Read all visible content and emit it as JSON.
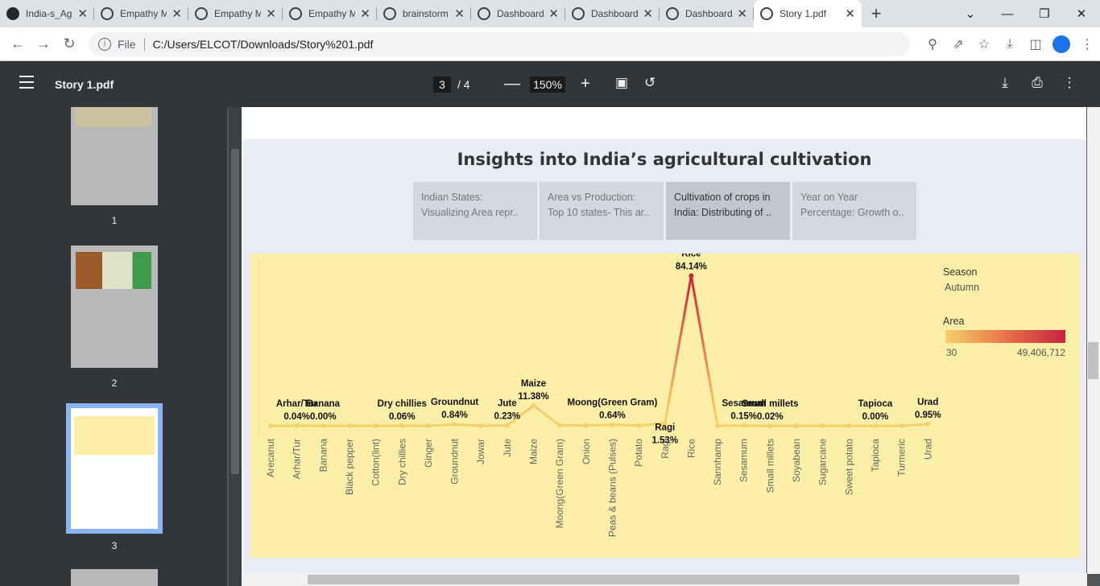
{
  "browser": {
    "tabs": [
      {
        "label": "India-s_Ag",
        "icon": "github-icon"
      },
      {
        "label": "Empathy M",
        "icon": "globe-icon"
      },
      {
        "label": "Empathy M",
        "icon": "globe-icon"
      },
      {
        "label": "Empathy M",
        "icon": "globe-icon"
      },
      {
        "label": "brainstorm",
        "icon": "globe-icon"
      },
      {
        "label": "Dashboard",
        "icon": "globe-icon"
      },
      {
        "label": "Dashboard",
        "icon": "globe-icon"
      },
      {
        "label": "Dashboard",
        "icon": "globe-icon"
      },
      {
        "label": "Story 1.pdf",
        "icon": "globe-icon",
        "active": true
      }
    ],
    "address": {
      "scheme": "File",
      "url": "C:/Users/ELCOT/Downloads/Story%201.pdf"
    }
  },
  "pdf": {
    "title": "Story 1.pdf",
    "current_page": "3",
    "total_pages": "/  4",
    "zoom": "150%",
    "thumbnails": [
      "1",
      "2",
      "3"
    ]
  },
  "dashboard": {
    "title": "Insights into India’s agricultural cultivation",
    "story_points": [
      {
        "line1": "Indian States:",
        "line2": "Visualizing Area repr.."
      },
      {
        "line1": "Area vs Production:",
        "line2": "Top 10 states- This ar.."
      },
      {
        "line1": "Cultivation of crops in",
        "line2": "India: Distributing of ..",
        "active": true
      },
      {
        "line1": "Year on Year",
        "line2": "Percentage: Growth o.."
      }
    ],
    "legend": {
      "season_title": "Season",
      "season_value": "Autumn",
      "area_title": "Area",
      "area_min": "30",
      "area_max": "49,406,712",
      "colors": {
        "low": "#f5d06a",
        "mid": "#e8734a",
        "high": "#c8233f"
      }
    }
  },
  "chart_data": {
    "type": "line",
    "title": "",
    "xlabel": "",
    "ylabel": "",
    "categories": [
      "Arecanut",
      "Arhar/Tur",
      "Banana",
      "Black pepper",
      "Cotton(lint)",
      "Dry chillies",
      "Ginger",
      "Groundnut",
      "Jowar",
      "Jute",
      "Maize",
      "Moong(Green Gram)",
      "Onion",
      "Peas & beans (Pulses)",
      "Potato",
      "Ragi",
      "Rice",
      "Sannhamp",
      "Sesamum",
      "Small millets",
      "Soyabean",
      "Sugarcane",
      "Sweet potato",
      "Tapioca",
      "Turmeric",
      "Urad"
    ],
    "series": [
      {
        "values": [
          0.0,
          0.04,
          0.0,
          0.0,
          0.0,
          0.06,
          0.0,
          0.84,
          0.0,
          0.23,
          11.38,
          0.3,
          0.1,
          0.64,
          0.1,
          1.53,
          84.14,
          0.05,
          0.15,
          0.02,
          0.0,
          0.0,
          0.0,
          0.0,
          0.0,
          0.95
        ]
      }
    ],
    "ylim": [
      0,
      88
    ],
    "point_labels": [
      {
        "index": 1,
        "line1": "Arhar/Tur",
        "line2": "0.04%",
        "pos": "above"
      },
      {
        "index": 2,
        "line1": "Banana",
        "line2": "0.00%",
        "pos": "above"
      },
      {
        "index": 5,
        "line1": "Dry chillies",
        "line2": "0.06%",
        "pos": "above"
      },
      {
        "index": 7,
        "line1": "Groundnut",
        "line2": "0.84%",
        "pos": "above"
      },
      {
        "index": 9,
        "line1": "Jute",
        "line2": "0.23%",
        "pos": "above"
      },
      {
        "index": 10,
        "line1": "Maize",
        "line2": "11.38%",
        "pos": "above"
      },
      {
        "index": 13,
        "line1": "Moong(Green Gram)",
        "line2": "0.64%",
        "pos": "above"
      },
      {
        "index": 15,
        "line1": "Ragi",
        "line2": "1.53%",
        "pos": "below"
      },
      {
        "index": 16,
        "line1": "Rice",
        "line2": "84.14%",
        "pos": "above"
      },
      {
        "index": 18,
        "line1": "Sesamum",
        "line2": "0.15%",
        "pos": "above"
      },
      {
        "index": 19,
        "line1": "Small millets",
        "line2": "0.02%",
        "pos": "above"
      },
      {
        "index": 23,
        "line1": "Tapioca",
        "line2": "0.00%",
        "pos": "above"
      },
      {
        "index": 25,
        "line1": "Urad",
        "line2": "0.95%",
        "pos": "above"
      }
    ],
    "grid": false,
    "legend": "top-right"
  }
}
